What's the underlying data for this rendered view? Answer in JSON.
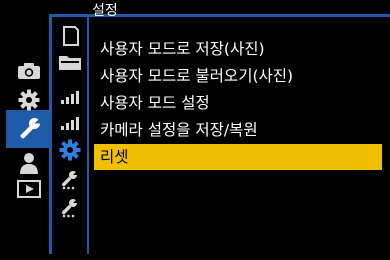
{
  "header": {
    "title": "설정"
  },
  "categories": [
    {
      "name": "camera-icon",
      "selected": false
    },
    {
      "name": "gear-icon",
      "selected": false
    },
    {
      "name": "wrench-icon",
      "selected": true
    },
    {
      "name": "person-icon",
      "selected": false
    },
    {
      "name": "playback-icon",
      "selected": false
    }
  ],
  "subtabs": [
    {
      "name": "memory-card-icon",
      "selected": false
    },
    {
      "name": "folder-icon",
      "selected": false
    },
    {
      "name": "wireless-1-icon",
      "selected": false
    },
    {
      "name": "wireless-2-icon",
      "selected": false
    },
    {
      "name": "gear-icon",
      "selected": true
    },
    {
      "name": "wrench-1-icon",
      "selected": false
    },
    {
      "name": "wrench-2-icon",
      "selected": false
    }
  ],
  "menu": {
    "items": [
      {
        "label": "사용자 모드로 저장(사진)"
      },
      {
        "label": "사용자 모드로 불러오기(사진)"
      },
      {
        "label": "사용자 모드 설정"
      },
      {
        "label": "카메라 설정을 저장/복원"
      },
      {
        "label": "리셋",
        "selected": true
      }
    ]
  },
  "colors": {
    "accent": "#1e5ba8",
    "highlight": "#f0c000",
    "icon": "#d8d8d8"
  }
}
